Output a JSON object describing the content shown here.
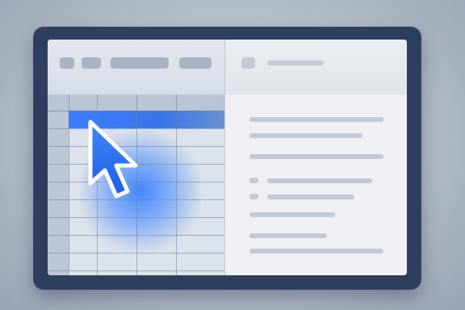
{
  "toolbar": {
    "buttons": [
      {
        "icon": "toolbar-button-1"
      },
      {
        "icon": "toolbar-button-2"
      },
      {
        "icon": "toolbar-button-wide"
      },
      {
        "icon": "toolbar-button-4"
      }
    ]
  },
  "spreadsheet": {
    "columns": 5,
    "rows": 10,
    "selected_row": 1
  },
  "detail_panel": {
    "header_icon": "panel-icon",
    "text_lines": 9
  },
  "cursor": {
    "icon": "arrow-cursor-icon"
  },
  "colors": {
    "accent": "#3b7dff",
    "frame": "#2d3e5e",
    "background": "#b3bcc8"
  }
}
